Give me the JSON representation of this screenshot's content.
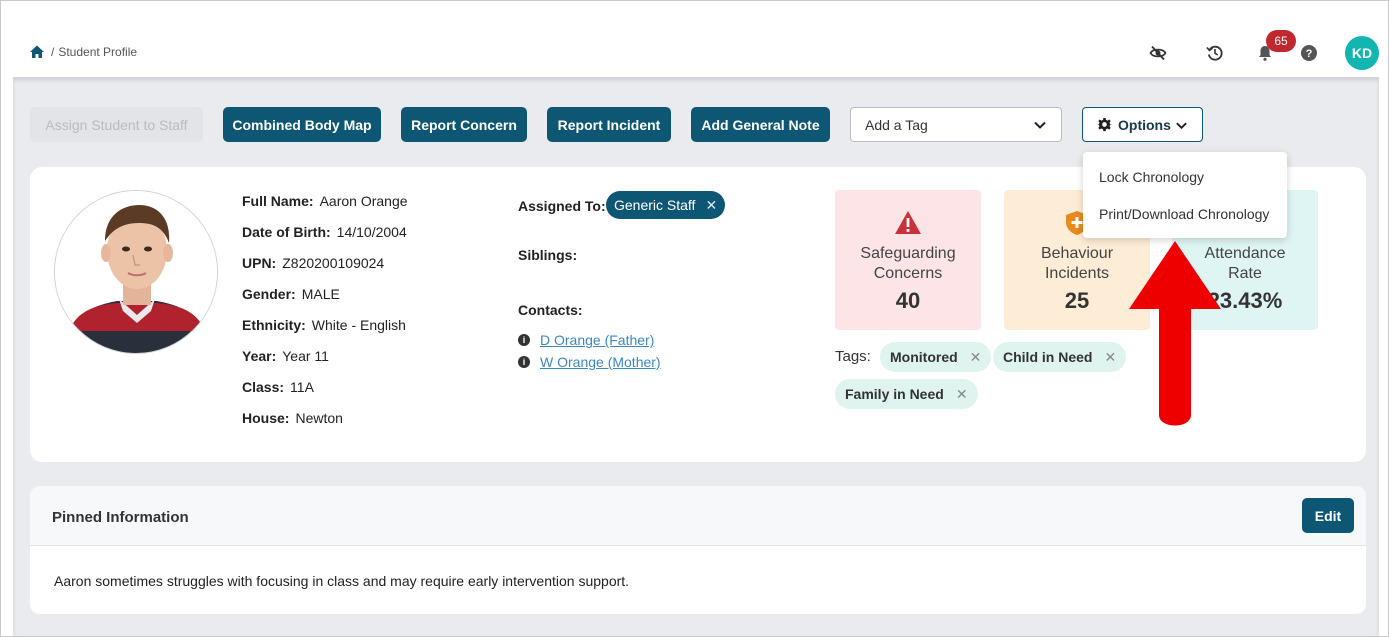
{
  "breadcrumb": {
    "home_icon": "home-icon",
    "separator": "/",
    "page": "Student Profile"
  },
  "header": {
    "icons": [
      "eye-off-icon",
      "history-icon",
      "bell-icon",
      "help-icon"
    ],
    "notification_count": "65",
    "user_initials": "KD",
    "avatar_color": "#12b5b0"
  },
  "toolbar": {
    "assign_label": "Assign Student to Staff",
    "combined_body_map_label": "Combined Body Map",
    "report_concern_label": "Report Concern",
    "report_incident_label": "Report Incident",
    "add_general_note_label": "Add General Note",
    "tag_placeholder": "Add a Tag",
    "options_label": "Options"
  },
  "options_menu": {
    "items": [
      "Lock Chronology",
      "Print/Download Chronology"
    ]
  },
  "student": {
    "fields": [
      {
        "label": "Full Name:",
        "value": "Aaron Orange"
      },
      {
        "label": "Date of Birth:",
        "value": "14/10/2004"
      },
      {
        "label": "UPN:",
        "value": "Z820200109024"
      },
      {
        "label": "Gender:",
        "value": "MALE"
      },
      {
        "label": "Ethnicity:",
        "value": "White - English"
      },
      {
        "label": "Year:",
        "value": "Year 11"
      },
      {
        "label": "Class:",
        "value": "11A"
      },
      {
        "label": "House:",
        "value": "Newton"
      }
    ],
    "assigned_to_label": "Assigned To:",
    "assigned_to": "Generic Staff",
    "siblings_label": "Siblings:",
    "contacts_label": "Contacts:",
    "contacts": [
      "D Orange (Father)",
      "W Orange (Mother)"
    ]
  },
  "stats": [
    {
      "title_line1": "Safeguarding",
      "title_line2": "Concerns",
      "value": "40",
      "bg": "#fde4e6",
      "icon": "warning-icon"
    },
    {
      "title_line1": "Behaviour",
      "title_line2": "Incidents",
      "value": "25",
      "bg": "#fdecd6",
      "icon": "shield-plus-icon"
    },
    {
      "title_line1": "Attendance",
      "title_line2": "Rate",
      "value": "23.43%",
      "bg": "#def5f3",
      "icon": ""
    }
  ],
  "tags": {
    "label": "Tags:",
    "items": [
      "Monitored",
      "Child in Need",
      "Family in Need"
    ]
  },
  "pinned": {
    "title": "Pinned Information",
    "edit_label": "Edit",
    "body": "Aaron sometimes struggles with focusing in class and may require early intervention support."
  },
  "colors": {
    "primary": "#0d5775",
    "badge": "#c0282d",
    "arrow": "#ee0000"
  }
}
